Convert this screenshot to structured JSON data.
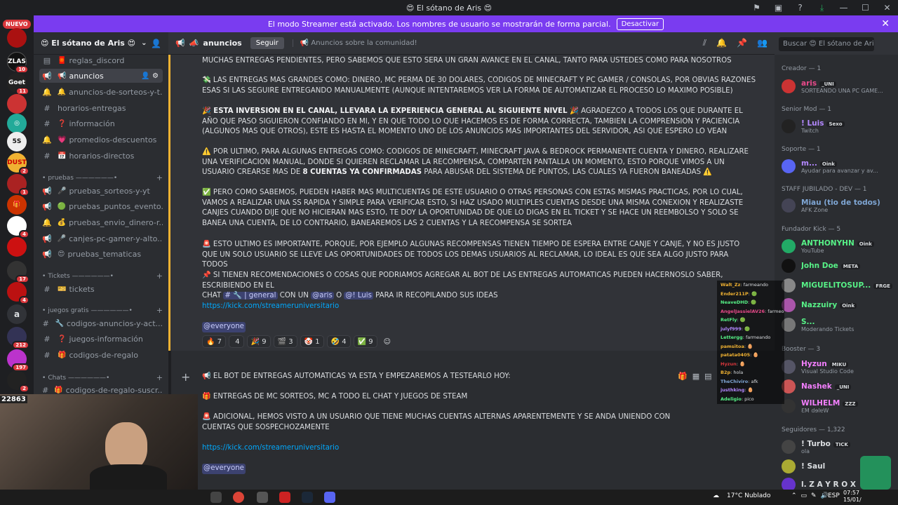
{
  "window": {
    "title": "😍 El sótano de Aris 😍"
  },
  "streamer_banner": {
    "text": "El modo Streamer está activado. Los nombres de usuario se mostrarán de forma parcial.",
    "button": "Desactivar"
  },
  "server_rail": {
    "new_label": "NUEVO",
    "badges": [
      "10",
      "11",
      "2",
      "1",
      "4",
      "17",
      "4",
      "212",
      "197",
      "2"
    ],
    "dm_letter": "a",
    "viewer_count": "22863"
  },
  "server": {
    "name": "😍 El sótano de Aris 😍"
  },
  "channels": [
    {
      "icon": "▤",
      "emoji": "🧧",
      "label": "reglas_discord"
    },
    {
      "icon": "📢",
      "emoji": "📢",
      "label": "anuncios"
    },
    {
      "icon": "🔔",
      "emoji": "🔔",
      "label": "anuncios-de-sorteos-y-t..."
    },
    {
      "icon": "#",
      "emoji": "",
      "label": "horarios-entregas"
    },
    {
      "icon": "#",
      "emoji": "❓",
      "label": "información"
    },
    {
      "icon": "🔔",
      "emoji": "💗",
      "label": "promedios-descuentos"
    },
    {
      "icon": "#",
      "emoji": "📅",
      "label": "horarios-directos"
    },
    {
      "icon": "📢",
      "emoji": "🎤",
      "label": "pruebas_sorteos-y-yt"
    },
    {
      "icon": "📢",
      "emoji": "🟢",
      "label": "pruebas_puntos_evento..."
    },
    {
      "icon": "🔔",
      "emoji": "💰",
      "label": "pruebas_envio_dinero-r..."
    },
    {
      "icon": "📢",
      "emoji": "🎤",
      "label": "canjes-pc-gamer-y-alto..."
    },
    {
      "icon": "📢",
      "emoji": "😍",
      "label": "pruebas_tematicas"
    },
    {
      "icon": "#",
      "emoji": "🎫",
      "label": "tickets"
    },
    {
      "icon": "#",
      "emoji": "🔧",
      "label": "codigos-anuncios-y-act..."
    },
    {
      "icon": "#",
      "emoji": "❓",
      "label": "juegos-información"
    },
    {
      "icon": "#",
      "emoji": "🎁",
      "label": "codigos-de-regalo"
    },
    {
      "icon": "#",
      "emoji": "🎁",
      "label": "codigos-de-regalo-suscr..."
    }
  ],
  "categories": [
    "pruebas",
    "Tickets",
    "juegos gratis",
    "Chats"
  ],
  "header": {
    "channel": "anuncios",
    "follow": "Seguir",
    "topic": "📢 Anuncios sobre la comunidad!",
    "search": "Buscar 😍 El sótano de Aris 😍"
  },
  "message": {
    "p1": "MUCHAS ENTREGAS PENDIENTES, PERO SABEMOS QUE ESTO SERA UN GRAN AVANCE EN EL CANAL, TANTO PARA USTEDES COMO PARA NOSOTROS",
    "p2": "💸 LAS ENTREGAS MAS GRANDES COMO: DINERO, MC PERMA DE 30 DOLARES, CODIGOS DE MINECRAFT Y PC GAMER / CONSOLAS, POR OBVIAS RAZONES ESAS SI LAS SEGUIRE ENTREGANDO MANUALMENTE (AUNQUE INTENTAREMOS VER LA FORMA DE AUTOMATIZAR EL PROCESO LO MAXIMO POSIBLE)",
    "p3_bold": "🎉 ESTA INVERSION EN EL CANAL, LLEVARA LA EXPERIENCIA GENERAL AL SIGUIENTE NIVEL 🎉",
    "p3_rest": " AGRADEZCO A TODOS LOS QUE DURANTE EL AÑO QUE PASO SIGUIERON CONFIANDO EN MI, Y EN QUE TODO LO QUE HACEMOS ES DE FORMA CORRECTA, TAMBIEN LA COMPRENSION Y PACIENCIA (ALGUNOS MAS QUE OTROS), ESTE ES HASTA EL MOMENTO UNO DE LOS ANUNCIOS MAS IMPORTANTES DEL SERVIDOR, ASI QUE ESPERO LO VEAN",
    "p4_a": "⚠️ POR ULTIMO, PARA ALGUNAS ENTREGAS COMO: CODIGOS DE MINECRAFT, MINECRAFT JAVA & BEDROCK PERMANENTE CUENTA Y DINERO, REALIZARE UNA VERIFICACION MANUAL, DONDE SI QUIEREN RECLAMAR LA RECOMPENSA, COMPARTEN PANTALLA UN MOMENTO, ESTO PORQUE VIMOS A UN USUARIO CREARSE MAS DE ",
    "p4_bold": "8 CUENTAS YA CONFIRMADAS",
    "p4_b": " PARA ABUSAR DEL SISTEMA DE PUNTOS, LAS CUALES YA FUERON BANEADAS ⚠️",
    "p5": "✅ PERO COMO SABEMOS, PUEDEN HABER MAS MULTICUENTAS DE ESTE USUARIO O OTRAS PERSONAS CON ESTAS MISMAS PRACTICAS, POR LO CUAL, VAMOS A REALIZAR UNA SS RAPIDA Y SIMPLE PARA VERIFICAR ESTO, SI HAZ USADO MULTIPLES CUENTAS DESDE UNA MISMA CONEXION Y REALIZASTE CANJES CUANDO DIJE QUE NO HICIERAN MAS ESTO, TE DOY LA OPORTUNIDAD DE QUE LO DIGAS EN EL TICKET Y SE HACE UN REEMBOLSO Y SOLO SE BANEA UNA CUENTA, DE LO CONTRARIO, BANEAREMOS LAS 2 CUENTAS Y LA RECOMPENSA SE SORTEA",
    "p6": "🚨 ESTO ULTIMO ES IMPORTANTE, PORQUE, POR EJEMPLO ALGUNAS RECOMPENSAS TIENEN TIEMPO DE ESPERA ENTRE CANJE Y CANJE, Y NO ES JUSTO QUE UN SOLO USUARIO SE LLEVE LAS OPORTUNIDADES DE TODOS LOS DEMAS USUARIOS AL RECLAMAR, LO IDEAL ES QUE SEA ALGO JUSTO PARA TODOS",
    "p7_a": "📌 SI TIENEN RECOMENDACIONES O COSAS QUE PODRIAMOS AGREGAR AL BOT DE LAS ENTREGAS AUTOMATICAS PUEDEN HACERNOSLO SABER, ESCRIBIENDO EN EL ",
    "p7_b": "CHAT ",
    "p7_ch": "# 🔧 | general",
    "p7_c": " CON UN ",
    "p7_m1": "@aris",
    "p7_d": " O ",
    "p7_m2": "@! Luis",
    "p7_e": " PARA IR RECOPILANDO SUS IDEAS",
    "link": "https://kick.com/streameruniversitario",
    "everyone": "@everyone"
  },
  "reactions": [
    {
      "e": "🔥",
      "n": "7"
    },
    {
      "e": "",
      "n": "4"
    },
    {
      "e": "🎉",
      "n": "9"
    },
    {
      "e": "🎬",
      "n": "3"
    },
    {
      "e": "🤡",
      "n": "1"
    },
    {
      "e": "🤣",
      "n": "4"
    },
    {
      "e": "✅",
      "n": "9"
    }
  ],
  "reply": {
    "l1": "📢 EL BOT DE ENTREGAS AUTOMATICAS YA ESTA Y EMPEZAREMOS A TESTEARLO HOY:",
    "l2": "🎁 ENTREGAS DE MC SORTEOS, MC A TODO EL CHAT Y JUEGOS DE STEAM",
    "l3": "🚨 ADICIONAL, HEMOS VISTO A UN USUARIO QUE TIENE MUCHAS CUENTAS ALTERNAS APARENTEMENTE Y SE ANDA UNIENDO CON CUENTAS QUE SOSPECHOZAMENTE",
    "link": "https://kick.com/streameruniversitario",
    "everyone": "@everyone"
  },
  "member_cats": [
    "Creador — 1",
    "Senior Mod — 1",
    "Soporte — 1",
    "STAFF JUBILADO - DEV — 1",
    "Fundador Kick — 5",
    "Booster — 3",
    "Seguidores — 1,322"
  ],
  "members": [
    {
      "name": "aris",
      "tag": "_UNI",
      "status": "SORTEANDO UNA PC GAME...",
      "color": "#e84a8a",
      "av": "#c33"
    },
    {
      "name": "! Luis",
      "tag": "Sexo",
      "status": "Twitch",
      "color": "#b388ff",
      "av": "#222"
    },
    {
      "name": "m...",
      "tag": "Oink",
      "status": "Ayudar para avanzar y av...",
      "color": "#b388ff",
      "av": "#5865f2"
    },
    {
      "name": "Miau (tio de todos)",
      "tag": "",
      "status": "AFK Zone",
      "color": "#7fa6d4",
      "av": "#445"
    },
    {
      "name": "ANTHONYHN",
      "tag": "Oink",
      "status": "YouTube",
      "color": "#57f287",
      "av": "#2a6"
    },
    {
      "name": "John Doe",
      "tag": "META",
      "status": "",
      "color": "#57f287",
      "av": "#111"
    },
    {
      "name": "MIGUELITOSUP...",
      "tag": "FRGE",
      "status": "",
      "color": "#57f287",
      "av": "#888"
    },
    {
      "name": "Nazzuiry",
      "tag": "Oink",
      "status": "",
      "color": "#57f287",
      "av": "#a5a"
    },
    {
      "name": "S...",
      "tag": "",
      "status": "Moderando Tickets",
      "color": "#57f287",
      "av": "#777"
    },
    {
      "name": "Hyzun",
      "tag": "MIKU",
      "status": "Visual Studio Code",
      "color": "#f47fff",
      "av": "#556"
    },
    {
      "name": "Nashek",
      "tag": "_UNI",
      "status": "",
      "color": "#f47fff",
      "av": "#c55"
    },
    {
      "name": "WILHELM",
      "tag": "ZZZ",
      "status": "ƐM dɘlɐW",
      "color": "#f47fff",
      "av": "#333"
    },
    {
      "name": "! Turbo",
      "tag": "TICK",
      "status": "ola",
      "color": "#dbdee1",
      "av": "#444"
    },
    {
      "name": "! Saul",
      "tag": "",
      "status": "",
      "color": "#dbdee1",
      "av": "#aa3"
    },
    {
      "name": "l. Z A Y R O X",
      "tag": "",
      "status": "",
      "color": "#dbdee1",
      "av": "#63c"
    }
  ],
  "stream_chat": [
    {
      "u": "Walt_Zz",
      "m": "farmeando",
      "c": "#f0b232"
    },
    {
      "u": "Ender211P",
      "m": "🟢",
      "c": "#f0b232"
    },
    {
      "u": "NeaveDHD",
      "m": "🟢",
      "c": "#57f287"
    },
    {
      "u": "AngelJassielAV26",
      "m": "farmeo",
      "c": "#e84a8a"
    },
    {
      "u": "RetFly",
      "m": "🟢",
      "c": "#57f287"
    },
    {
      "u": "julyf999",
      "m": "🟢",
      "c": "#b388ff"
    },
    {
      "u": "Lettergg",
      "m": "farmeando",
      "c": "#57f287"
    },
    {
      "u": "pamsitoa",
      "m": "🥚",
      "c": "#f0b232"
    },
    {
      "u": "patata0405",
      "m": "🥚",
      "c": "#f0b232"
    },
    {
      "u": "Hyzun",
      "m": "🥚",
      "c": "#da373c"
    },
    {
      "u": "B2p",
      "m": "hola",
      "c": "#f0b232"
    },
    {
      "u": "TheChiviro",
      "m": "afk",
      "c": "#7fa6d4"
    },
    {
      "u": "justhking",
      "m": "🥚",
      "c": "#b388ff"
    },
    {
      "u": "Adeligio",
      "m": "pico",
      "c": "#57f287"
    }
  ],
  "taskbar": {
    "weather": "17°C Nublado",
    "lang": "ESP",
    "time": "07:57",
    "date": "15/01/"
  }
}
